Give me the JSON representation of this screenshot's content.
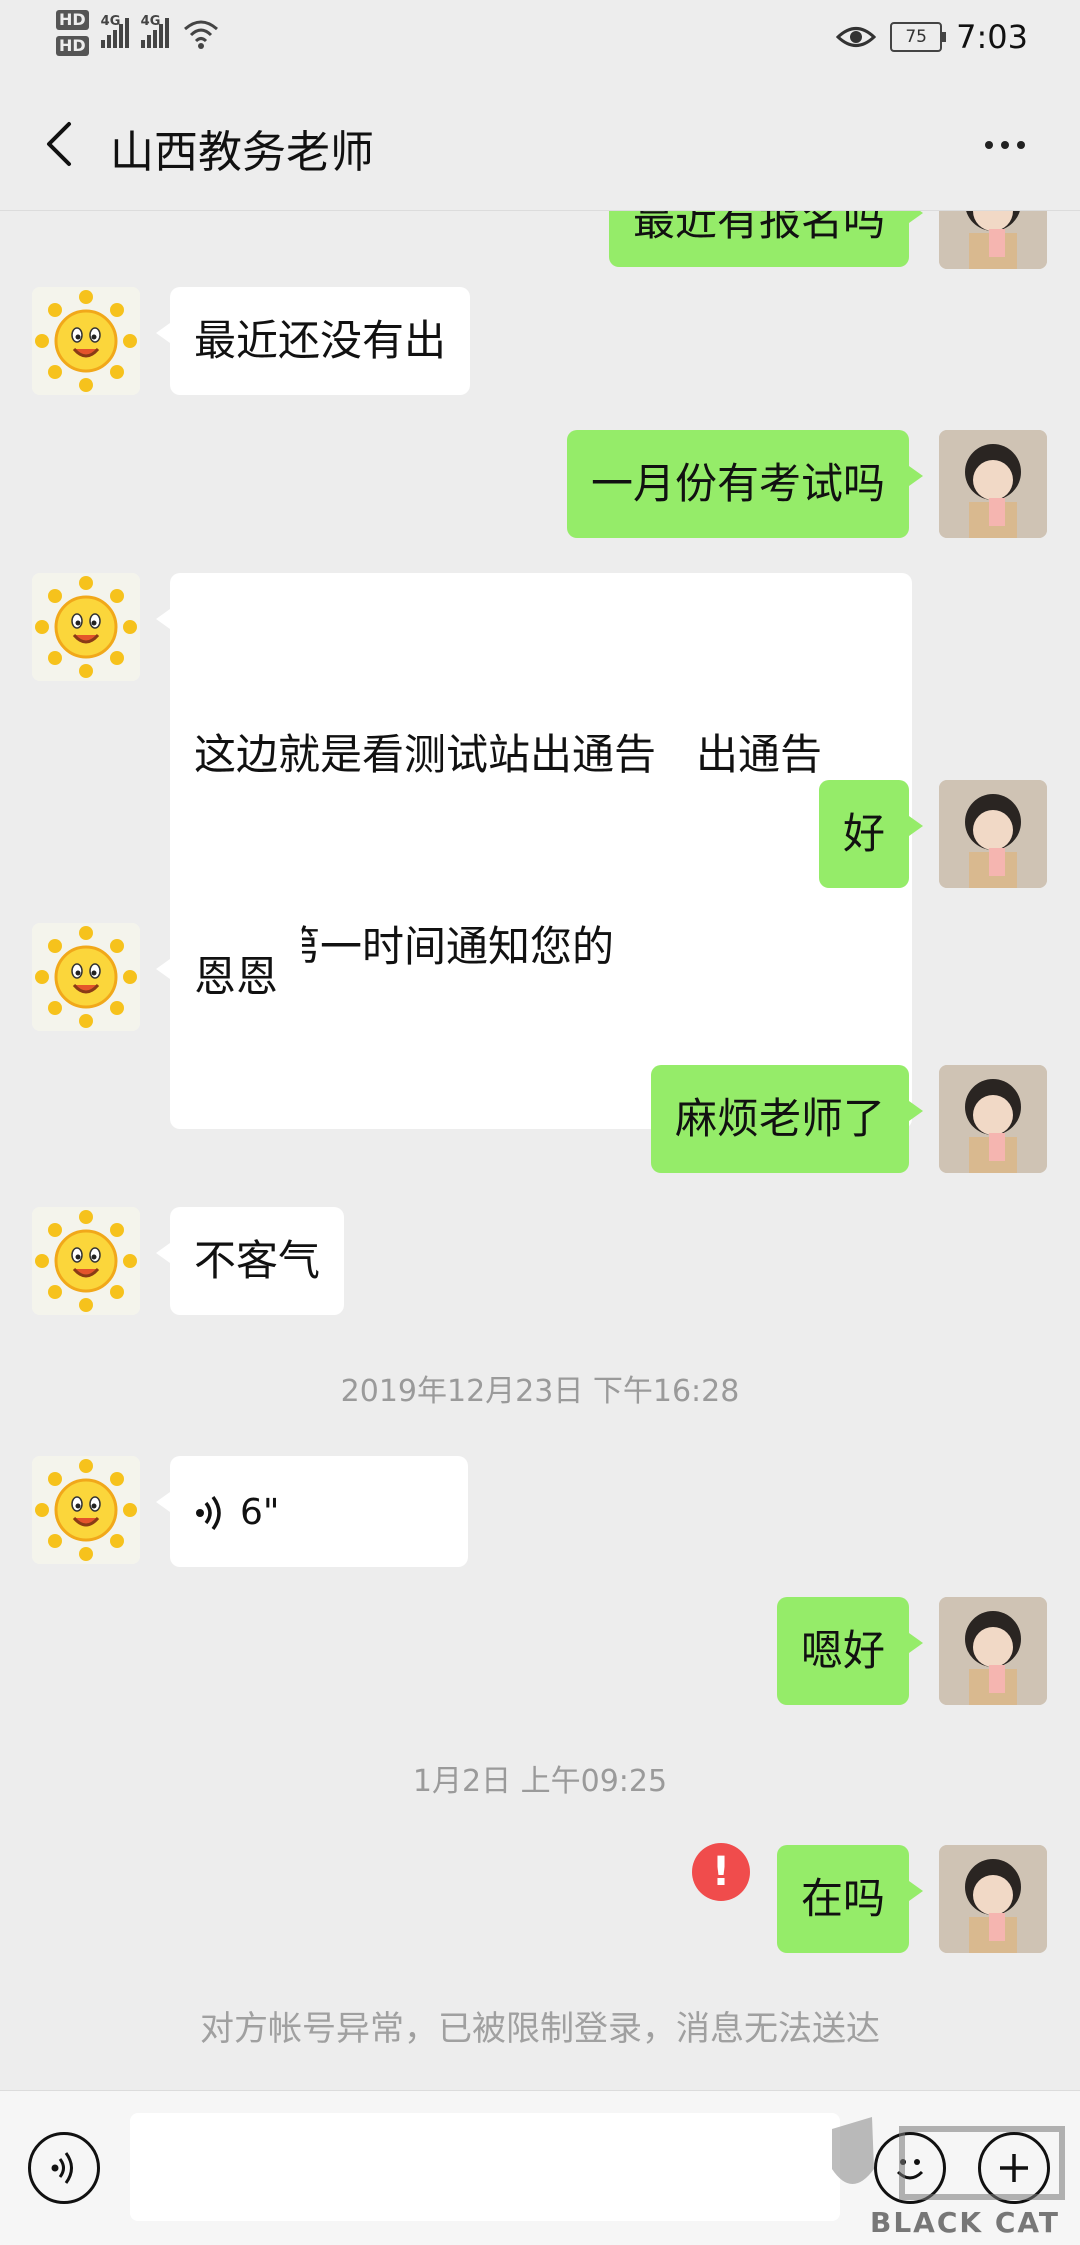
{
  "status_bar": {
    "time": "7:03",
    "battery": "75",
    "hd1": "HD",
    "hd2": "HD",
    "net1": "4G",
    "net2": "4G"
  },
  "header": {
    "title": "山西教务老师"
  },
  "messages": {
    "m0": "最近有报名吗",
    "m1": "最近还没有出",
    "m2": "一月份有考试吗",
    "m3_line1": "这边就是看测试站出通告   出通告",
    "m3_line2": "我会第一时间通知您的",
    "m4": "好",
    "m5": "恩恩",
    "m6": "麻烦老师了",
    "m7": "不客气",
    "ts1": "2019年12月23日 下午16:28",
    "voice_duration": "6\"",
    "m9": "嗯好",
    "ts2": "1月2日 上午09:25",
    "m10": "在吗",
    "error_mark": "!",
    "system_notice": "对方帐号异常，已被限制登录，消息无法送达"
  },
  "input": {
    "placeholder": ""
  },
  "watermark": {
    "text": "BLACK CAT"
  },
  "colors": {
    "outgoing_bubble": "#95ec69",
    "incoming_bubble": "#ffffff",
    "background": "#ededed",
    "error": "#f04c4c"
  }
}
